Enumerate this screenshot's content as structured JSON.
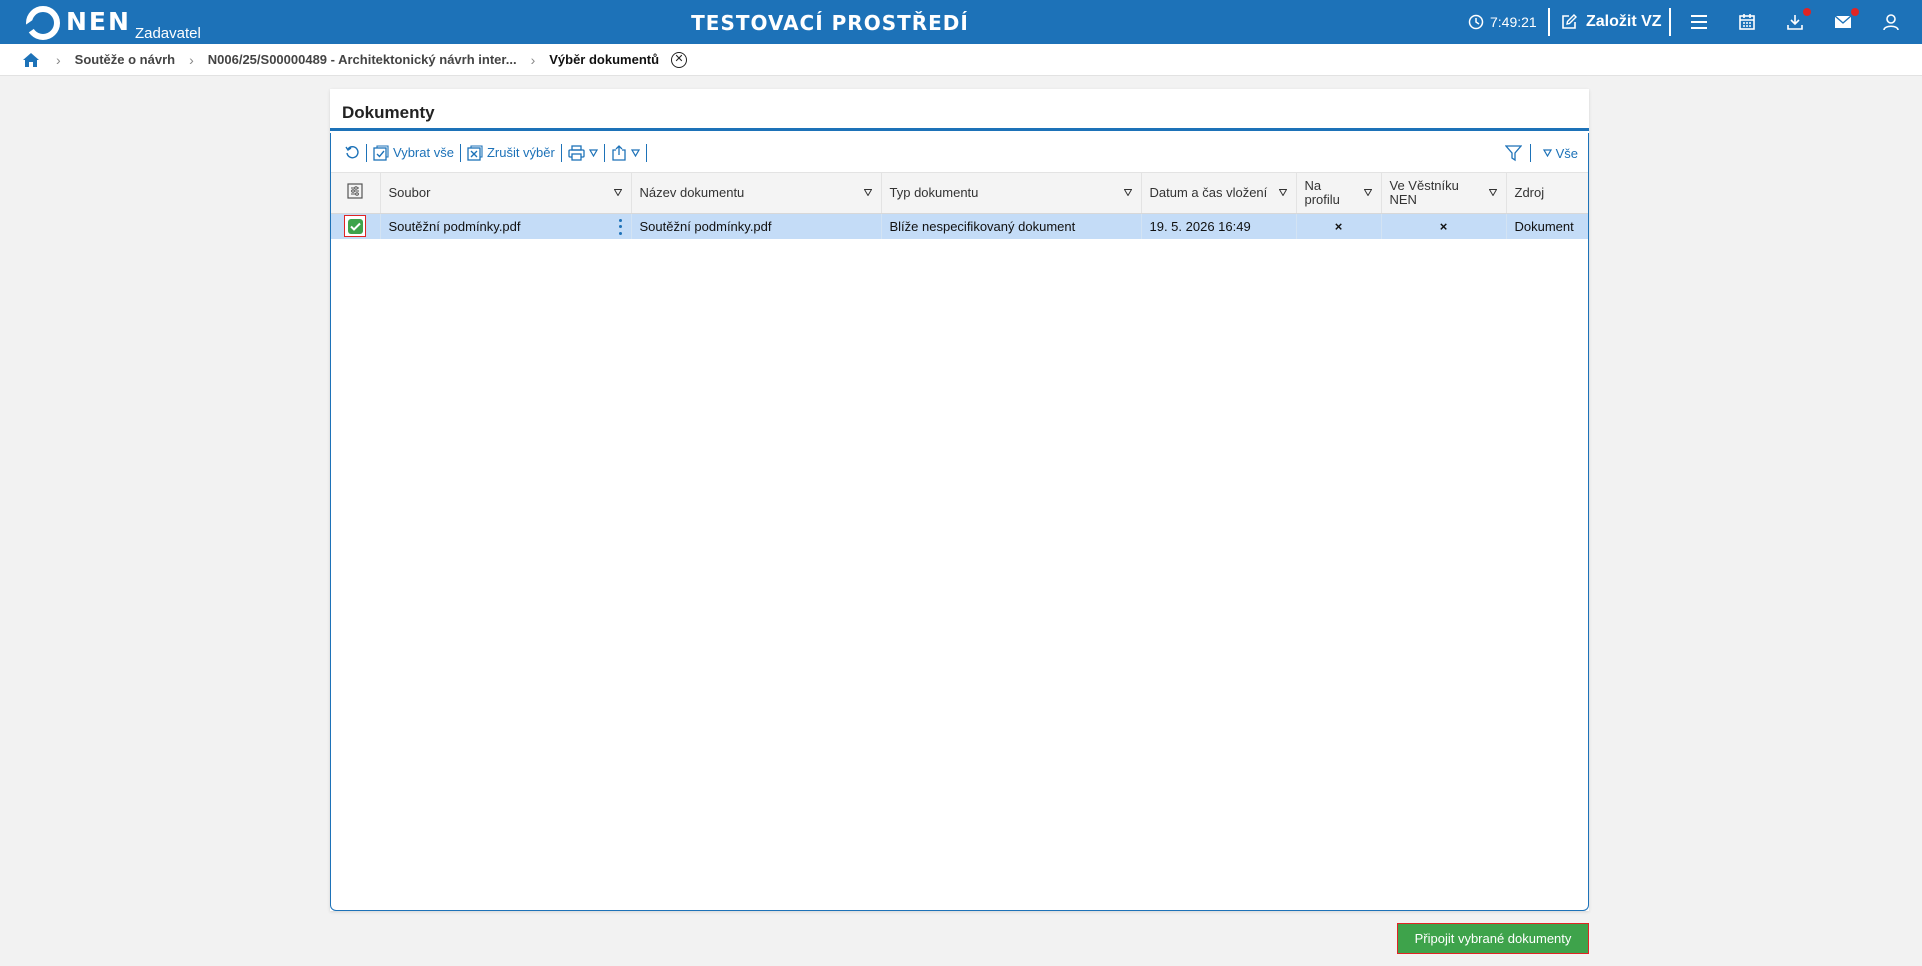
{
  "header": {
    "logo_text": "NEN",
    "logo_subtitle": "Zadavatel",
    "environment_title": "TESTOVACÍ PROSTŘEDÍ",
    "clock": "7:49:21",
    "create_label": "Založit VZ",
    "icons": [
      "clock-icon",
      "edit-icon",
      "menu-icon",
      "calendar-icon",
      "download-icon",
      "mail-icon",
      "user-icon"
    ],
    "notification_color": "#e02424"
  },
  "breadcrumb": {
    "items": [
      "Soutěže o návrh",
      "N006/25/S00000489 - Architektonický návrh inter...",
      "Výběr dokumentů"
    ]
  },
  "panel": {
    "title": "Dokumenty"
  },
  "toolbar": {
    "select_all": "Vybrat vše",
    "cancel_selection": "Zrušit výběr",
    "filter_all": "Vše"
  },
  "table": {
    "columns": [
      "Soubor",
      "Název dokumentu",
      "Typ dokumentu",
      "Datum a čas vložení",
      "Na profilu",
      "Ve Věstníku NEN",
      "Zdroj"
    ],
    "rows": [
      {
        "selected": true,
        "soubor": "Soutěžní podmínky.pdf",
        "nazev": "Soutěžní podmínky.pdf",
        "typ": "Blíže nespecifikovaný dokument",
        "datum": "19. 5. 2026 16:49",
        "na_profilu": "×",
        "ve_vestniku": "×",
        "zdroj": "Dokument"
      }
    ]
  },
  "actions": {
    "attach_selected": "Připojit vybrané dokumenty"
  },
  "colors": {
    "brand_blue": "#1d72b8",
    "selected_row": "#c4dcf7",
    "success_green": "#3ea34b",
    "error_red": "#d12a2a"
  }
}
